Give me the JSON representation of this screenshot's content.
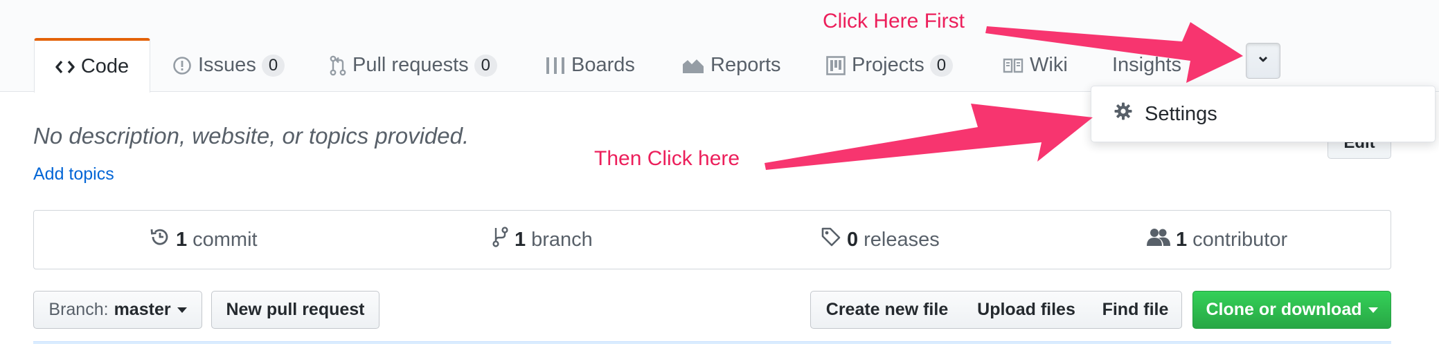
{
  "tabs": [
    {
      "label": "Code",
      "icon": "code-icon",
      "selected": true
    },
    {
      "label": "Issues",
      "icon": "issue-icon",
      "count": "0"
    },
    {
      "label": "Pull requests",
      "icon": "pull-request-icon",
      "count": "0"
    },
    {
      "label": "Boards",
      "icon": "boards-icon"
    },
    {
      "label": "Reports",
      "icon": "graph-icon"
    },
    {
      "label": "Projects",
      "icon": "project-icon",
      "count": "0"
    },
    {
      "label": "Wiki",
      "icon": "book-icon"
    },
    {
      "label": "Insights",
      "icon": "insights-icon"
    }
  ],
  "more_menu": {
    "item": "Settings",
    "icon": "gear-icon"
  },
  "repo": {
    "description": "No description, website, or topics provided.",
    "add_topics": "Add topics",
    "edit_label": "Edit"
  },
  "summary": {
    "commits": {
      "count": "1",
      "label": "commit"
    },
    "branches": {
      "count": "1",
      "label": "branch"
    },
    "releases": {
      "count": "0",
      "label": "releases"
    },
    "contributors": {
      "count": "1",
      "label": "contributor"
    }
  },
  "file_nav": {
    "branch_prefix": "Branch:",
    "branch_name": "master",
    "new_pull_request": "New pull request",
    "create_new_file": "Create new file",
    "upload_files": "Upload files",
    "find_file": "Find file",
    "clone_or_download": "Clone or download"
  },
  "annotations": {
    "first": "Click Here First",
    "second": "Then Click here",
    "color": "#ec1f5b"
  },
  "colors": {
    "accent_tab": "#e36209",
    "link": "#0366d6",
    "green_button": "#28a745"
  }
}
